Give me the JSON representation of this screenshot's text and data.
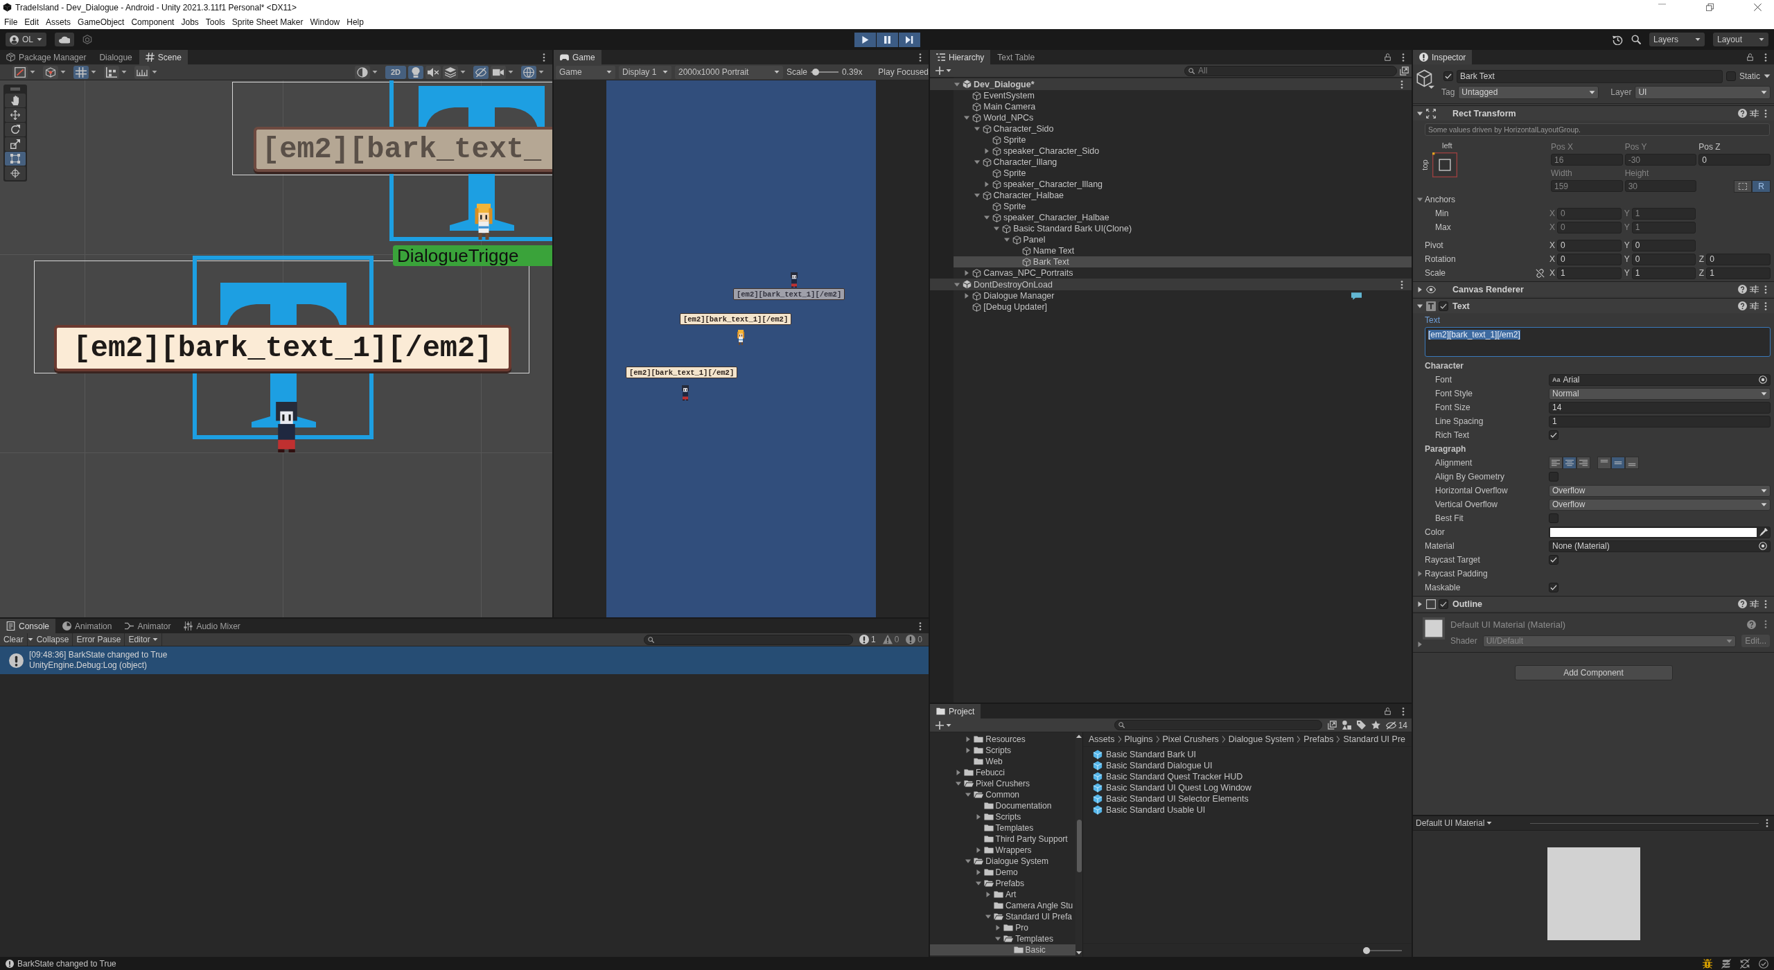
{
  "title_bar": {
    "title": "TradeIsland - Dev_Dialogue - Android - Unity 2021.3.11f1 Personal* <DX11>"
  },
  "menu_bar": [
    "File",
    "Edit",
    "Assets",
    "GameObject",
    "Component",
    "Jobs",
    "Tools",
    "Sprite Sheet Maker",
    "Window",
    "Help"
  ],
  "main_toolbar": {
    "account": "OL",
    "play_mode": true,
    "layers": "Layers",
    "layout": "Layout"
  },
  "scene_panel": {
    "tabs": [
      {
        "label": "Package Manager",
        "selected": false
      },
      {
        "label": "Dialogue",
        "selected": false
      },
      {
        "label": "Scene",
        "selected": true
      }
    ],
    "toolbar_left": [
      {
        "kind": "handle",
        "selected": false
      },
      {
        "kind": "pivot",
        "selected": false
      },
      {
        "kind": "grid",
        "selected": true
      },
      {
        "kind": "snap",
        "selected": false
      },
      {
        "kind": "increment",
        "selected": false
      }
    ],
    "toolbar_right": [
      {
        "kind": "draw_mode",
        "selected": false
      },
      {
        "kind": "mode_2d",
        "label": "2D",
        "selected": true
      },
      {
        "kind": "lighting",
        "selected": true
      },
      {
        "kind": "audio",
        "selected": false
      },
      {
        "kind": "effects",
        "selected": false
      },
      {
        "kind": "hidden",
        "selected": true
      },
      {
        "kind": "camera",
        "selected": false
      },
      {
        "kind": "gizmos",
        "selected": true
      }
    ],
    "tools": [
      {
        "kind": "hand",
        "selected": false
      },
      {
        "kind": "move",
        "selected": false
      },
      {
        "kind": "rotate",
        "selected": false
      },
      {
        "kind": "scale",
        "selected": false
      },
      {
        "kind": "rect",
        "selected": true
      },
      {
        "kind": "transform",
        "selected": false
      }
    ],
    "bark_bubbles": [
      {
        "kind": "faded",
        "text": "[em2][bark_text_"
      },
      {
        "kind": "lit",
        "text": "[em2][bark_text_1][/em2]"
      }
    ],
    "trigger_label": "DialogueTrigge"
  },
  "game_panel": {
    "tabs": [
      {
        "label": "Game",
        "selected": true
      }
    ],
    "toolbar": {
      "view": "Game",
      "display": "Display 1",
      "resolution": "2000x1000 Portrait",
      "scale_label": "Scale",
      "scale": {
        "level": 0.08
      },
      "scale_value": "0.39x",
      "play_focused": "Play Focused"
    },
    "bark_bubbles": [
      {
        "kind": "faded",
        "text": "[em2][bark_text_1][/em2]"
      },
      {
        "kind": "lit",
        "text": "[em2][bark_text_1][/em2]"
      },
      {
        "kind": "lit",
        "text": "[em2][bark_text_1][/em2]"
      }
    ]
  },
  "console": {
    "tabs": [
      {
        "label": "Console",
        "selected": true
      },
      {
        "label": "Animation",
        "selected": false
      },
      {
        "label": "Animator",
        "selected": false
      },
      {
        "label": "Audio Mixer",
        "selected": false
      }
    ],
    "toolbar": {
      "clear": "Clear",
      "collapse": "Collapse",
      "error_pause": "Error Pause",
      "editor": "Editor"
    },
    "counts": [
      {
        "kind": "info",
        "count": "1"
      },
      {
        "kind": "warning",
        "count": "0"
      },
      {
        "kind": "error",
        "count": "0"
      }
    ],
    "entries": [
      {
        "kind": "info",
        "message": "[09:48:36] BarkState changed to True",
        "detail": "UnityEngine.Debug:Log (object)",
        "selected": true
      }
    ]
  },
  "hierarchy": {
    "tabs": [
      {
        "label": "Hierarchy",
        "selected": true
      },
      {
        "label": "Text Table",
        "selected": false
      }
    ],
    "search": {
      "placeholder": "All"
    },
    "tree": [
      {
        "label": "Dev_Dialogue*",
        "kind": "scene",
        "active": true,
        "expanded": true,
        "selected": false,
        "children": [
          {
            "label": "EventSystem",
            "kind": "object",
            "selected": false
          },
          {
            "label": "Main Camera",
            "kind": "object",
            "selected": false
          },
          {
            "label": "World_NPCs",
            "kind": "object",
            "expanded": true,
            "selected": false,
            "children": [
              {
                "label": "Character_Sido",
                "kind": "object",
                "expanded": true,
                "selected": false,
                "children": [
                  {
                    "label": "Sprite",
                    "kind": "object",
                    "selected": false
                  },
                  {
                    "label": "speaker_Character_Sido",
                    "kind": "object",
                    "expanded": false,
                    "selected": false
                  }
                ]
              },
              {
                "label": "Character_Illang",
                "kind": "object",
                "expanded": true,
                "selected": false,
                "children": [
                  {
                    "label": "Sprite",
                    "kind": "object",
                    "selected": false
                  },
                  {
                    "label": "speaker_Character_Illang",
                    "kind": "object",
                    "expanded": false,
                    "selected": false
                  }
                ]
              },
              {
                "label": "Character_Halbae",
                "kind": "object",
                "expanded": true,
                "selected": false,
                "children": [
                  {
                    "label": "Sprite",
                    "kind": "object",
                    "selected": false
                  },
                  {
                    "label": "speaker_Character_Halbae",
                    "kind": "object",
                    "expanded": true,
                    "selected": false,
                    "children": [
                      {
                        "label": "Basic Standard Bark UI(Clone)",
                        "kind": "object",
                        "expanded": true,
                        "selected": false,
                        "children": [
                          {
                            "label": "Panel",
                            "kind": "object",
                            "expanded": true,
                            "selected": false,
                            "children": [
                              {
                                "label": "Name Text",
                                "kind": "object",
                                "selected": false
                              },
                              {
                                "label": "Bark Text",
                                "kind": "object",
                                "selected": true
                              }
                            ]
                          }
                        ]
                      }
                    ]
                  }
                ]
              }
            ]
          },
          {
            "label": "Canvas_NPC_Portraits",
            "kind": "object",
            "expanded": false,
            "selected": false
          }
        ]
      },
      {
        "label": "DontDestroyOnLoad",
        "kind": "scene",
        "active": false,
        "expanded": true,
        "selected": false,
        "children": [
          {
            "label": "Dialogue Manager",
            "kind": "object",
            "expanded": false,
            "selected": false,
            "badge": true
          },
          {
            "label": "[Debug Updater]",
            "kind": "object",
            "selected": false
          }
        ]
      }
    ]
  },
  "project": {
    "tabs": [
      {
        "label": "Project",
        "selected": true
      }
    ],
    "hidden_count": "14",
    "tree": [
      {
        "children": [
          {
            "label": "Resources",
            "expanded": false,
            "selected": false
          },
          {
            "label": "Scripts",
            "expanded": false,
            "selected": false
          },
          {
            "label": "Web",
            "selected": false
          }
        ]
      },
      {
        "label": "Febucci",
        "expanded": false,
        "selected": false
      },
      {
        "label": "Pixel Crushers",
        "expanded": true,
        "selected": false,
        "children": [
          {
            "label": "Common",
            "expanded": true,
            "selected": false,
            "children": [
              {
                "label": "Documentation",
                "selected": false
              },
              {
                "label": "Scripts",
                "expanded": false,
                "selected": false
              },
              {
                "label": "Templates",
                "selected": false
              },
              {
                "label": "Third Party Support",
                "selected": false
              },
              {
                "label": "Wrappers",
                "expanded": false,
                "selected": false
              }
            ]
          },
          {
            "label": "Dialogue System",
            "expanded": true,
            "selected": false,
            "children": [
              {
                "label": "Demo",
                "expanded": false,
                "selected": false
              },
              {
                "label": "Prefabs",
                "expanded": true,
                "selected": false,
                "children": [
                  {
                    "label": "Art",
                    "expanded": false,
                    "selected": false
                  },
                  {
                    "label": "Camera Angle Stu",
                    "selected": false
                  },
                  {
                    "label": "Standard UI Prefa",
                    "expanded": true,
                    "selected": false,
                    "children": [
                      {
                        "label": "Pro",
                        "expanded": false,
                        "selected": false
                      },
                      {
                        "label": "Templates",
                        "expanded": true,
                        "selected": false,
                        "children": [
                          {
                            "label": "Basic",
                            "selected": true
                          }
                        ]
                      }
                    ]
                  }
                ]
              }
            ]
          }
        ]
      }
    ],
    "breadcrumbs": [
      "Assets",
      "Plugins",
      "Pixel Crushers",
      "Dialogue System",
      "Prefabs",
      "Standard UI Pre"
    ],
    "assets": [
      "Basic Standard Bark UI",
      "Basic Standard Dialogue UI",
      "Basic Standard Quest Tracker HUD",
      "Basic Standard UI Quest Log Window",
      "Basic Standard UI Selector Elements",
      "Basic Standard Usable UI"
    ],
    "icon_size": {
      "level": 0
    }
  },
  "inspector": {
    "tabs": [
      {
        "label": "Inspector",
        "selected": true
      }
    ],
    "object": {
      "active": true,
      "name": "Bark Text",
      "static": false,
      "static_label": "Static",
      "tag_label": "Tag",
      "tag": "Untagged",
      "layer_label": "Layer",
      "layer": "UI"
    },
    "components": [
      {
        "kind": "rect_transform",
        "title": "Rect Transform",
        "expanded": true,
        "note": "Some values driven by HorizontalLayoutGroup.",
        "anchor_h": "left",
        "anchor_v": "top",
        "position": [
          {
            "label": "Pos X",
            "value": "16",
            "disabled": true
          },
          {
            "label": "Pos Y",
            "value": "-30",
            "disabled": true
          },
          {
            "label": "Pos Z",
            "value": "0",
            "disabled": false
          }
        ],
        "size": [
          {
            "label": "Width",
            "value": "159",
            "disabled": true
          },
          {
            "label": "Height",
            "value": "30",
            "disabled": true
          }
        ],
        "blueprint": {
          "selected": false
        },
        "raw_edit": {
          "label": "R",
          "selected": true
        },
        "anchors": {
          "label": "Anchors",
          "expanded": true,
          "rows": [
            {
              "label": "Min",
              "disabled": true,
              "fields": [
                {
                  "axis": "X",
                  "value": "0"
                },
                {
                  "axis": "Y",
                  "value": "1"
                }
              ]
            },
            {
              "label": "Max",
              "disabled": true,
              "fields": [
                {
                  "axis": "X",
                  "value": "0"
                },
                {
                  "axis": "Y",
                  "value": "1"
                }
              ]
            }
          ]
        },
        "vectors": [
          {
            "label": "Pivot",
            "disabled": false,
            "fields": [
              {
                "axis": "X",
                "value": "0"
              },
              {
                "axis": "Y",
                "value": "0"
              }
            ]
          },
          {
            "label": "Rotation",
            "disabled": false,
            "fields": [
              {
                "axis": "X",
                "value": "0"
              },
              {
                "axis": "Y",
                "value": "0"
              },
              {
                "axis": "Z",
                "value": "0"
              }
            ]
          },
          {
            "label": "Scale",
            "disabled": false,
            "constrained": false,
            "fields": [
              {
                "axis": "X",
                "value": "1"
              },
              {
                "axis": "Y",
                "value": "1"
              },
              {
                "axis": "Z",
                "value": "1"
              }
            ]
          }
        ]
      },
      {
        "kind": "canvas_renderer",
        "title": "Canvas Renderer",
        "expanded": false
      },
      {
        "kind": "text",
        "title": "Text",
        "expanded": true,
        "enabled": true,
        "properties": [
          {
            "kind": "text_area",
            "label": "Text",
            "value": "[em2][bark_text_1][/em2]",
            "focused": true,
            "text_selected": true
          },
          {
            "kind": "section",
            "label": "Character",
            "children": [
              {
                "kind": "font",
                "label": "Font",
                "icon": "Aa",
                "value": "Arial"
              },
              {
                "kind": "dropdown",
                "label": "Font Style",
                "value": "Normal"
              },
              {
                "kind": "number",
                "label": "Font Size",
                "value": "14"
              },
              {
                "kind": "number",
                "label": "Line Spacing",
                "value": "1"
              },
              {
                "kind": "checkbox",
                "label": "Rich Text",
                "checked": true
              }
            ]
          },
          {
            "kind": "section",
            "label": "Paragraph",
            "children": [
              {
                "kind": "alignment",
                "label": "Alignment",
                "buttons": [
                  {
                    "kind": "left",
                    "selected": false
                  },
                  {
                    "kind": "center",
                    "selected": true
                  },
                  {
                    "kind": "right",
                    "selected": false
                  },
                  {
                    "kind": "top",
                    "selected": false
                  },
                  {
                    "kind": "middle",
                    "selected": true
                  },
                  {
                    "kind": "bottom",
                    "selected": false
                  }
                ]
              },
              {
                "kind": "checkbox",
                "label": "Align By Geometry",
                "checked": false
              },
              {
                "kind": "dropdown",
                "label": "Horizontal Overflow",
                "value": "Overflow"
              },
              {
                "kind": "dropdown",
                "label": "Vertical Overflow",
                "value": "Overflow"
              },
              {
                "kind": "checkbox",
                "label": "Best Fit",
                "checked": false
              }
            ]
          },
          {
            "kind": "color",
            "label": "Color",
            "color": "#ffffff"
          },
          {
            "kind": "object",
            "label": "Material",
            "value": "None (Material)"
          },
          {
            "kind": "checkbox",
            "label": "Raycast Target",
            "checked": true
          },
          {
            "kind": "foldout",
            "label": "Raycast Padding",
            "expanded": false
          },
          {
            "kind": "checkbox",
            "label": "Maskable",
            "checked": true
          }
        ]
      },
      {
        "kind": "outline",
        "title": "Outline",
        "expanded": false,
        "enabled": true
      },
      {
        "kind": "material",
        "title": "Default UI Material (Material)",
        "expanded": false,
        "read_only": true,
        "shader_label": "Shader",
        "shader": "UI/Default",
        "edit": "Edit..."
      }
    ],
    "add_component": "Add Component"
  },
  "preview": {
    "title": "Default UI Material"
  },
  "status_bar": {
    "kind": "info",
    "message": "BarkState changed to True"
  }
}
